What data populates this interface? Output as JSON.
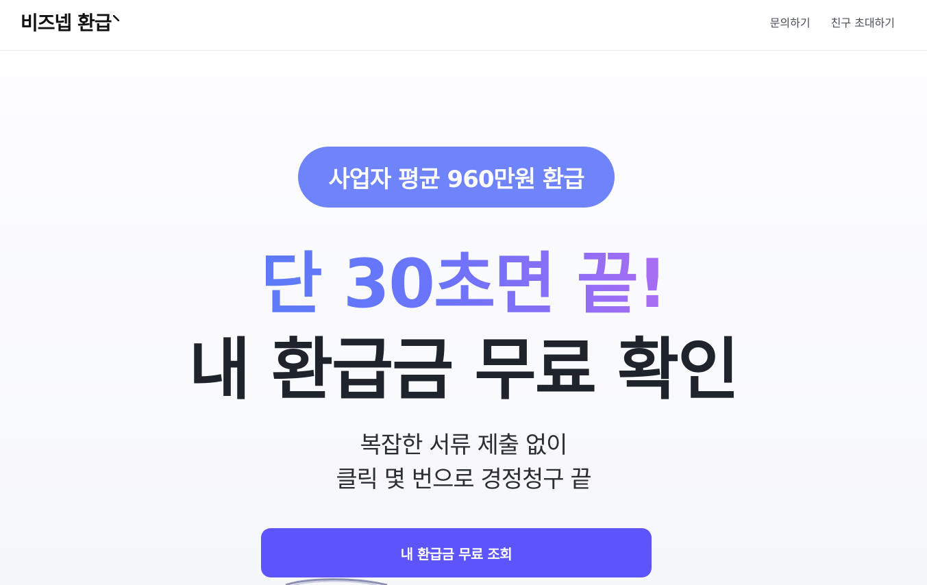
{
  "header": {
    "brand": "비즈넵 환급",
    "nav": [
      {
        "label": "문의하기"
      },
      {
        "label": "친구 초대하기"
      }
    ]
  },
  "hero": {
    "badge": "사업자 평균 960만원 환급",
    "headline_accent": "단 30초면 끝!",
    "headline_main": "내 환급금 무료 확인",
    "subcopy_lines": [
      "복잡한 서류 제출 없이",
      "클릭 몇 번으로 경정청구 끝"
    ],
    "cta": "내 환급금 무료 조회"
  },
  "colors": {
    "badge_bg": "#6f84fb",
    "cta_bg": "#5d55fb",
    "accent_start": "#5d7bf8",
    "accent_end": "#a96df2",
    "text_dark": "#1f232b"
  }
}
